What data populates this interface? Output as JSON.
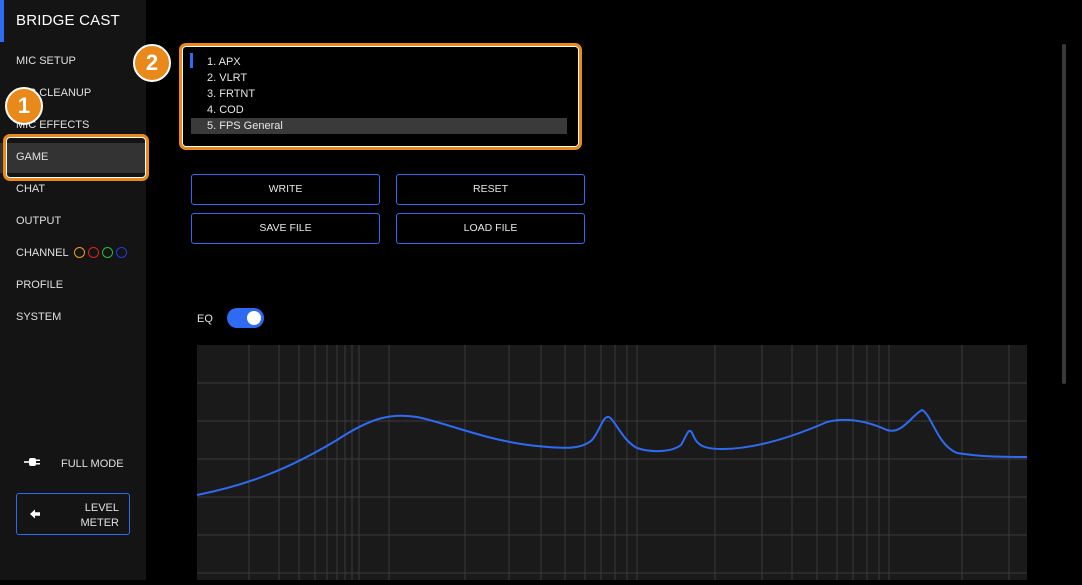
{
  "app": {
    "title": "BRIDGE CAST"
  },
  "sidebar": {
    "items": [
      {
        "label": "MIC SETUP"
      },
      {
        "label": "MIC CLEANUP"
      },
      {
        "label": "MIC EFFECTS"
      },
      {
        "label": "GAME"
      },
      {
        "label": "CHAT"
      },
      {
        "label": "OUTPUT"
      },
      {
        "label": "CHANNEL"
      },
      {
        "label": "PROFILE"
      },
      {
        "label": "SYSTEM"
      }
    ],
    "active": "GAME",
    "channel_colors": [
      "#e8a020",
      "#e02020",
      "#20c040",
      "#2040e0"
    ],
    "full_mode_label": "FULL MODE",
    "level_meter_label_1": "LEVEL",
    "level_meter_label_2": "METER"
  },
  "callouts": {
    "one": "1",
    "two": "2"
  },
  "presets": {
    "items": [
      "1. APX",
      "2. VLRT",
      "3. FRTNT",
      "4. COD",
      "5. FPS General"
    ],
    "selected_index": 4
  },
  "buttons": {
    "write": "WRITE",
    "reset": "RESET",
    "save_file": "SAVE FILE",
    "load_file": "LOAD FILE"
  },
  "eq": {
    "label": "EQ",
    "enabled": true
  },
  "colors": {
    "accent": "#2f6bf2",
    "callout": "#e8891a"
  }
}
